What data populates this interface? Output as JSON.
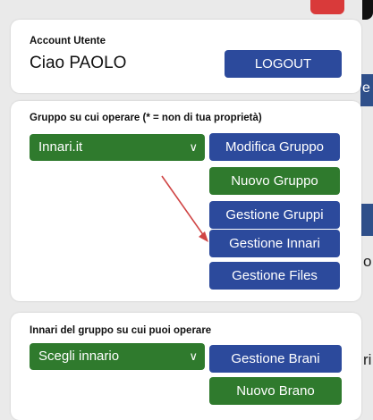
{
  "colors": {
    "blue": "#2c4a9c",
    "green": "#2f7a2d",
    "red_tab": "#d93a3a",
    "arrow": "#d04545"
  },
  "account": {
    "title": "Account Utente",
    "greeting": "Ciao PAOLO",
    "logout_label": "LOGOUT"
  },
  "group": {
    "title": "Gruppo su cui operare (* = non di tua proprietà)",
    "selected": "Innari.it",
    "buttons": {
      "edit": "Modifica Gruppo",
      "new": "Nuovo Gruppo",
      "manage_groups": "Gestione Gruppi",
      "manage_hymnals": "Gestione Innari",
      "manage_files": "Gestione Files"
    }
  },
  "hymnals": {
    "title": "Innari del gruppo su cui puoi operare",
    "selected": "Scegli innario",
    "buttons": {
      "manage_songs": "Gestione Brani",
      "new_song": "Nuovo Brano"
    }
  },
  "background_fragments": {
    "e": "e",
    "o": "o",
    "ri": "ri"
  }
}
